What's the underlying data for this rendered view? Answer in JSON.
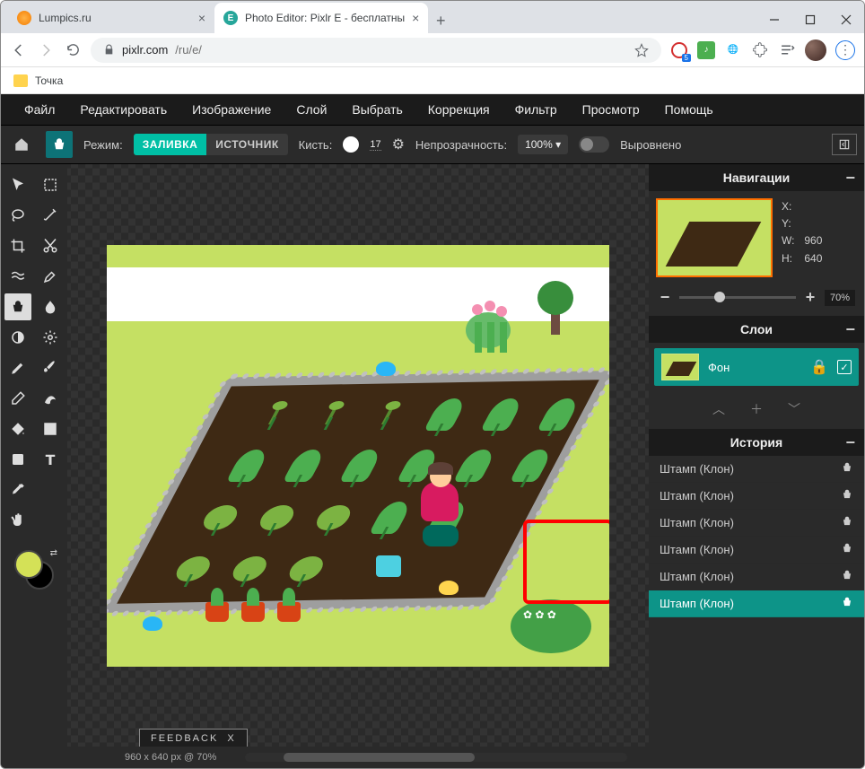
{
  "window": {
    "tabs": [
      {
        "title": "Lumpics.ru",
        "favicon": "orange"
      },
      {
        "title": "Photo Editor: Pixlr E - бесплатны",
        "favicon": "green-e"
      }
    ],
    "url_host": "pixlr.com",
    "url_path": "/ru/e/",
    "bookmark": "Точка"
  },
  "menubar": [
    "Файл",
    "Редактировать",
    "Изображение",
    "Слой",
    "Выбрать",
    "Коррекция",
    "Фильтр",
    "Просмотр",
    "Помощь"
  ],
  "options": {
    "mode_label": "Режим:",
    "mode_fill": "ЗАЛИВКА",
    "mode_source": "ИСТОЧНИК",
    "brush_label": "Кисть:",
    "brush_size": "17",
    "opacity_label": "Непрозрачность:",
    "opacity_value": "100%",
    "aligned_label": "Выровнено"
  },
  "tools": [
    "arrow",
    "marquee",
    "lasso",
    "wand",
    "crop",
    "cut",
    "liquify",
    "heal",
    "clone",
    "blur",
    "dodge",
    "gear",
    "eyedrop-brush",
    "brush",
    "eraser",
    "pattern",
    "fill",
    "gradient",
    "shape",
    "text",
    "eyedropper",
    "zoom",
    "hand"
  ],
  "nav_panel": {
    "title": "Навигации",
    "x_label": "X:",
    "y_label": "Y:",
    "w_label": "W:",
    "h_label": "H:",
    "w_value": "960",
    "h_value": "640",
    "zoom_value": "70%"
  },
  "layers_panel": {
    "title": "Слои",
    "layer_name": "Фон"
  },
  "history_panel": {
    "title": "История",
    "items": [
      "Штамп (Клон)",
      "Штамп (Клон)",
      "Штамп (Клон)",
      "Штамп (Клон)",
      "Штамп (Клон)",
      "Штамп (Клон)"
    ]
  },
  "footer": {
    "feedback": "FEEDBACK",
    "feedback_close": "X",
    "status": "960 x 640 px @ 70%"
  },
  "colors": {
    "foreground": "#d4e157",
    "background": "#000000",
    "accent": "#00bfa5"
  }
}
